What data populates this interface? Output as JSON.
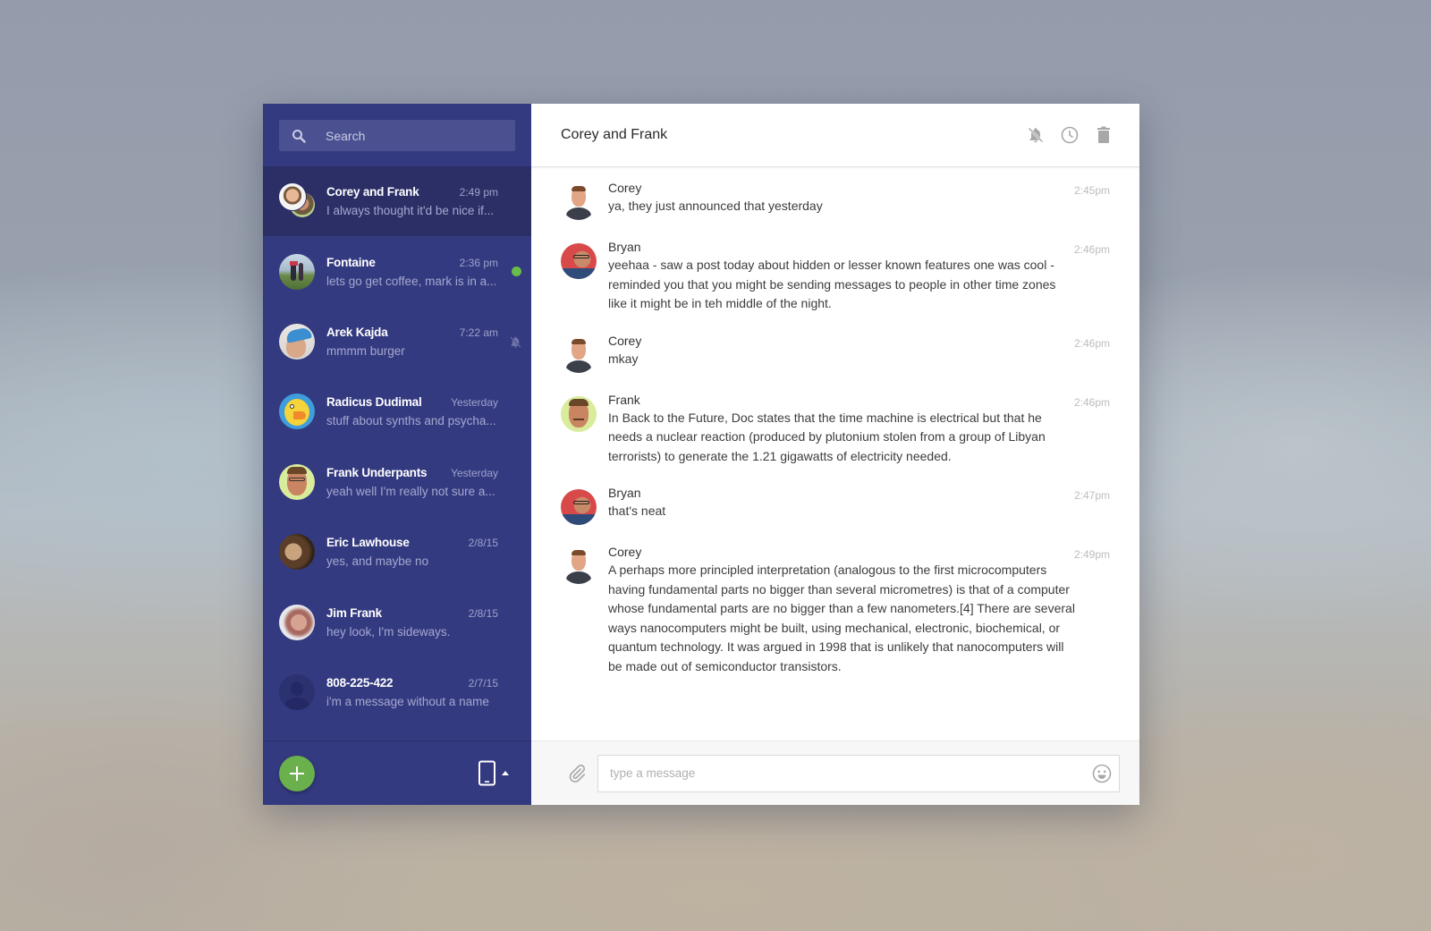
{
  "search": {
    "placeholder": "Search"
  },
  "conversations": [
    {
      "name": "Corey and Frank",
      "time": "2:49 pm",
      "preview": "I always thought it'd be nice if...",
      "active": true,
      "status": "",
      "avatar": "group"
    },
    {
      "name": "Fontaine",
      "time": "2:36 pm",
      "preview": "lets go get coffee, mark is in a...",
      "active": false,
      "status": "online",
      "avatar": "photo"
    },
    {
      "name": "Arek Kajda",
      "time": "7:22 am",
      "preview": "mmmm burger",
      "active": false,
      "status": "muted",
      "avatar": "photo"
    },
    {
      "name": "Radicus Dudimal",
      "time": "Yesterday",
      "preview": "stuff about synths and psycha...",
      "active": false,
      "status": "",
      "avatar": "photo"
    },
    {
      "name": "Frank Underpants",
      "time": "Yesterday",
      "preview": "yeah well I'm really not sure a...",
      "active": false,
      "status": "",
      "avatar": "photo"
    },
    {
      "name": "Eric Lawhouse",
      "time": "2/8/15",
      "preview": "yes, and maybe no",
      "active": false,
      "status": "",
      "avatar": "photo"
    },
    {
      "name": "Jim Frank",
      "time": "2/8/15",
      "preview": "hey look, I'm sideways.",
      "active": false,
      "status": "",
      "avatar": "photo"
    },
    {
      "name": "808-225-422",
      "time": "2/7/15",
      "preview": "i'm a message without a name",
      "active": false,
      "status": "",
      "avatar": "placeholder"
    }
  ],
  "footer": {
    "new_conversation_icon": "plus-icon",
    "device_icon": "phone-icon"
  },
  "chat": {
    "title": "Corey and Frank",
    "actions": [
      "mute-icon",
      "clock-icon",
      "trash-icon"
    ],
    "messages": [
      {
        "author": "Corey",
        "time": "2:45pm",
        "text": "ya, they just announced that yesterday"
      },
      {
        "author": "Bryan",
        "time": "2:46pm",
        "text": "yeehaa - saw a post today about hidden or lesser known features one was cool - reminded you that you might be sending messages to people in other time zones like it might be in teh middle of the night."
      },
      {
        "author": "Corey",
        "time": "2:46pm",
        "text": "mkay"
      },
      {
        "author": "Frank",
        "time": "2:46pm",
        "text": "In Back to the Future, Doc states that the time machine is electrical but that he needs a nuclear reaction (produced by plutonium stolen from a group of Libyan terrorists) to generate the 1.21 gigawatts of electricity needed."
      },
      {
        "author": "Bryan",
        "time": "2:47pm",
        "text": "that's neat"
      },
      {
        "author": "Corey",
        "time": "2:49pm",
        "text": "A perhaps more principled interpretation (analogous to the first microcomputers having fundamental parts no bigger than several micrometres) is that of a computer whose fundamental parts are no bigger than a few nanometers.[4] There are several ways nanocomputers might be built, using mechanical, electronic, biochemical, or quantum technology. It was argued in 1998 that is unlikely that nanocomputers will be made out of semiconductor transistors."
      }
    ]
  },
  "composer": {
    "placeholder": "type a message",
    "value": ""
  },
  "colors": {
    "sidebar": "#343a80",
    "sidebar_active": "#2b2f66",
    "accent_green": "#6ab04c",
    "online": "#6abb4a"
  }
}
